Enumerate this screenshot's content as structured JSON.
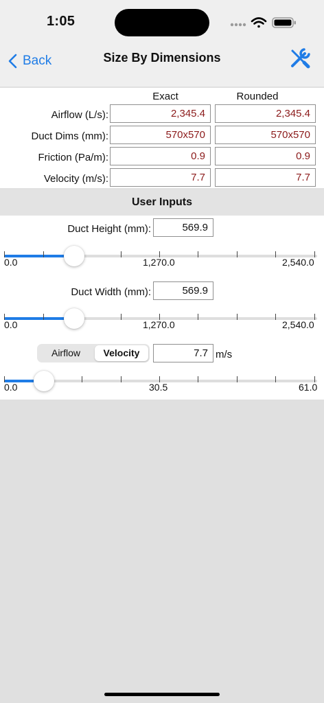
{
  "status": {
    "time": "1:05"
  },
  "nav": {
    "back_label": "Back",
    "title": "Size By Dimensions",
    "tools_icon": "wrench-screwdriver-icon",
    "accent": "#1f7ce6"
  },
  "results": {
    "headers": {
      "exact": "Exact",
      "rounded": "Rounded"
    },
    "rows": [
      {
        "label": "Airflow (L/s):",
        "exact": "2,345.4",
        "rounded": "2,345.4"
      },
      {
        "label": "Duct Dims (mm):",
        "exact": "570x570",
        "rounded": "570x570"
      },
      {
        "label": "Friction (Pa/m):",
        "exact": "0.9",
        "rounded": "0.9"
      },
      {
        "label": "Velocity (m/s):",
        "exact": "7.7",
        "rounded": "7.7"
      }
    ],
    "value_color": "#8b1a1a"
  },
  "inputs": {
    "section_title": "User Inputs",
    "height": {
      "label": "Duct Height (mm):",
      "value": "569.9",
      "min": "0.0",
      "mid": "1,270.0",
      "max": "2,540.0",
      "fraction": 0.2244
    },
    "width": {
      "label": "Duct Width (mm):",
      "value": "569.9",
      "min": "0.0",
      "mid": "1,270.0",
      "max": "2,540.0",
      "fraction": 0.2244
    },
    "mode": {
      "options": [
        "Airflow",
        "Velocity"
      ],
      "selected": "Velocity",
      "value": "7.7",
      "unit": "m/s",
      "min": "0.0",
      "mid": "30.5",
      "max": "61.0",
      "fraction": 0.1262
    }
  }
}
